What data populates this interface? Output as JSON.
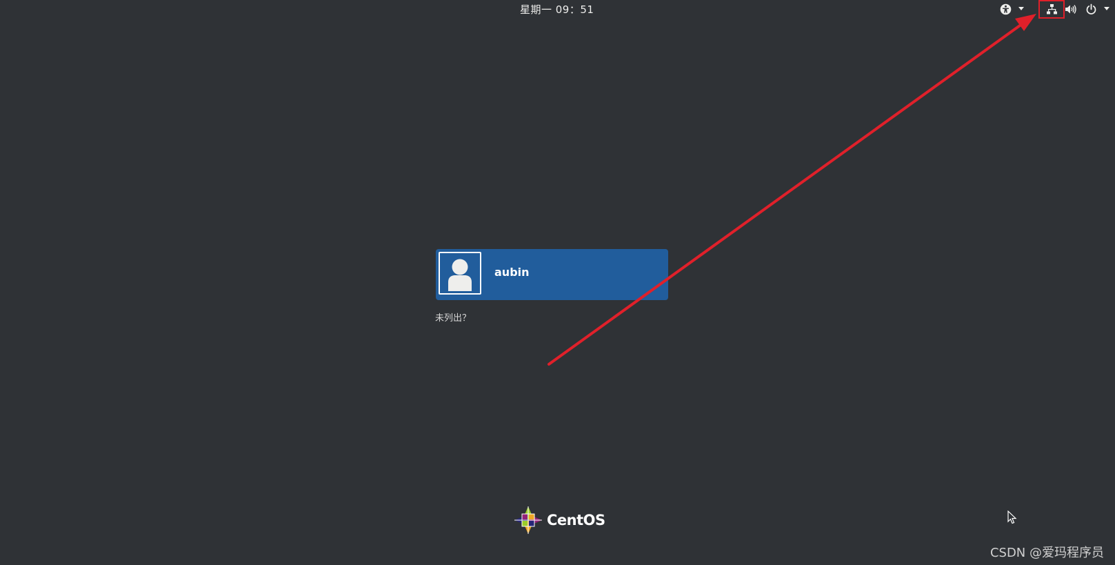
{
  "topbar": {
    "clock": "星期一  09：51",
    "icons": [
      "accessibility-icon",
      "network-icon",
      "volume-icon",
      "power-icon"
    ]
  },
  "login": {
    "username": "aubin",
    "not_listed": "未列出？"
  },
  "logo": {
    "text": "CentOS"
  },
  "watermark": {
    "text": "CSDN @爱玛程序员"
  },
  "colors": {
    "background": "#2f3236",
    "user_card": "#215d9c",
    "annotation": "#e0202a"
  }
}
